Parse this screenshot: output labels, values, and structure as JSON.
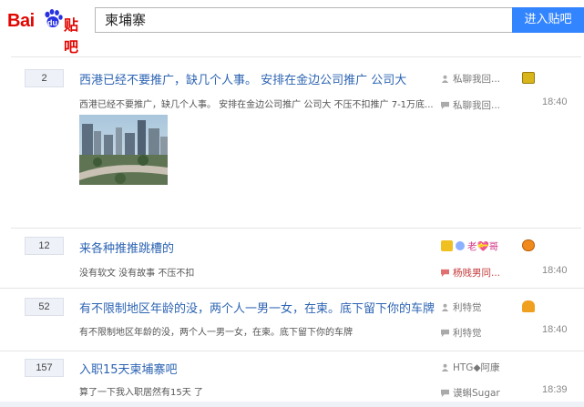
{
  "header": {
    "logo_bai": "Bai",
    "logo_du": "du",
    "logo_tieba": "贴吧",
    "search_value": "柬埔寨",
    "enter_button": "进入贴吧"
  },
  "threads": [
    {
      "reply_count": "2",
      "title": "西港已经不要推广，缺几个人事。 安排在金边公司推广 公司大",
      "excerpt": "西港已经不要推广，缺几个人事。 安排在金边公司推广 公司大 不压不扣推广 7-1万底...",
      "author": "私聊我回...",
      "last_reply_user": "私聊我回...",
      "time": "18:40",
      "badge_color": "#d8b51a"
    },
    {
      "reply_count": "12",
      "title": "来各种推推跳槽的",
      "excerpt": "没有软文 没有故事 不压不扣",
      "author": "老💝哥",
      "last_reply_user": "杨贱男同...",
      "time": "18:40",
      "badge_color": "#f08a1c"
    },
    {
      "reply_count": "52",
      "title": "有不限制地区年龄的没，两个人一男一女，在柬。底下留下你的车牌",
      "excerpt": "有不限制地区年龄的没，两个人一男一女，在柬。底下留下你的车牌",
      "author": "利特觉",
      "last_reply_user": "利特觉",
      "time": "18:40",
      "badge_color": "#f0a020"
    },
    {
      "reply_count": "157",
      "title": "入职15天柬埔寨吧",
      "excerpt": "算了一下我入职居然有15天 了",
      "author": "HTG◆阿康",
      "last_reply_user": "谟蝌Sugar",
      "time": "18:39"
    }
  ],
  "colors": {
    "link": "#2d64b3",
    "search_button": "#3385ff",
    "logo_red": "#e10601",
    "count_bg": "#eef1f7"
  }
}
